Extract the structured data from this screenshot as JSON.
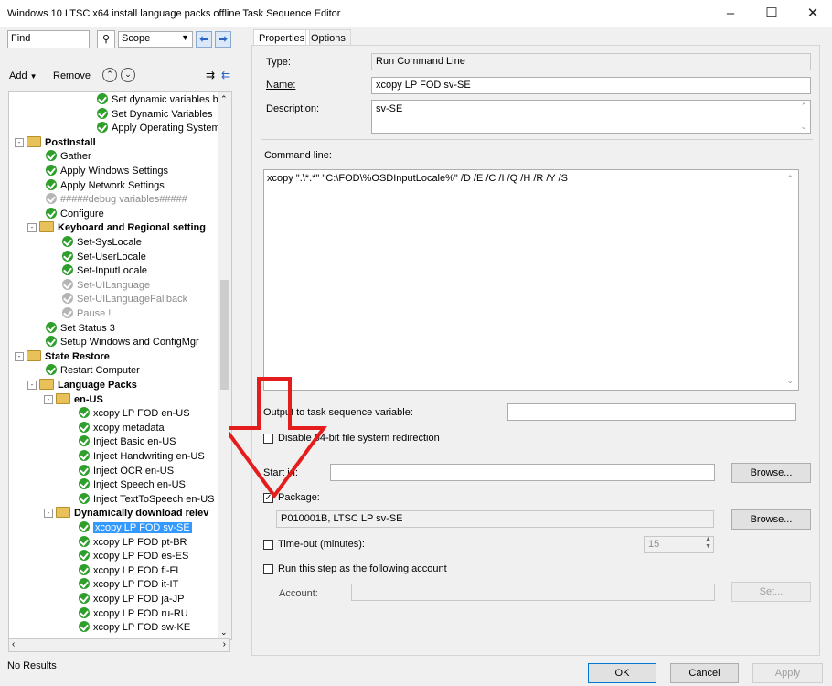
{
  "window": {
    "title": "Windows 10 LTSC x64 install language packs offline Task Sequence Editor"
  },
  "search": {
    "value": "Find",
    "scope": "Scope"
  },
  "toolbar": {
    "add": "Add",
    "remove": "Remove"
  },
  "tree": [
    {
      "label": "Set dynamic variables ba",
      "icon": "ok"
    },
    {
      "label": "Set Dynamic Variables",
      "icon": "ok"
    },
    {
      "label": "Apply Operating System I",
      "icon": "ok"
    },
    {
      "label": "PostInstall",
      "icon": "folder"
    },
    {
      "label": "Gather",
      "icon": "ok"
    },
    {
      "label": "Apply Windows Settings",
      "icon": "ok"
    },
    {
      "label": "Apply Network Settings",
      "icon": "ok"
    },
    {
      "label": "#####debug variables#####",
      "icon": "grey"
    },
    {
      "label": "Configure",
      "icon": "ok"
    },
    {
      "label": "Keyboard and Regional setting",
      "icon": "folder"
    },
    {
      "label": "Set-SysLocale",
      "icon": "ok"
    },
    {
      "label": "Set-UserLocale",
      "icon": "ok"
    },
    {
      "label": "Set-InputLocale",
      "icon": "ok"
    },
    {
      "label": "Set-UILanguage",
      "icon": "grey"
    },
    {
      "label": "Set-UILanguageFallback",
      "icon": "grey"
    },
    {
      "label": "Pause !",
      "icon": "grey"
    },
    {
      "label": "Set Status 3",
      "icon": "ok"
    },
    {
      "label": "Setup Windows and ConfigMgr",
      "icon": "ok"
    },
    {
      "label": "State Restore",
      "icon": "folder"
    },
    {
      "label": "Restart Computer",
      "icon": "ok"
    },
    {
      "label": "Language Packs",
      "icon": "folder"
    },
    {
      "label": "en-US",
      "icon": "folder"
    },
    {
      "label": "xcopy LP FOD en-US",
      "icon": "ok"
    },
    {
      "label": "xcopy metadata",
      "icon": "ok"
    },
    {
      "label": "Inject Basic en-US",
      "icon": "ok"
    },
    {
      "label": "Inject Handwriting en-US",
      "icon": "ok"
    },
    {
      "label": "Inject OCR en-US",
      "icon": "ok"
    },
    {
      "label": "Inject Speech en-US",
      "icon": "ok"
    },
    {
      "label": "Inject TextToSpeech en-US",
      "icon": "ok"
    },
    {
      "label": "Dynamically download relev",
      "icon": "folder"
    },
    {
      "label": "xcopy LP FOD sv-SE",
      "icon": "ok"
    },
    {
      "label": "xcopy LP FOD pt-BR",
      "icon": "ok"
    },
    {
      "label": "xcopy LP FOD es-ES",
      "icon": "ok"
    },
    {
      "label": "xcopy LP FOD fi-FI",
      "icon": "ok"
    },
    {
      "label": "xcopy LP FOD it-IT",
      "icon": "ok"
    },
    {
      "label": "xcopy LP FOD ja-JP",
      "icon": "ok"
    },
    {
      "label": "xcopy LP FOD  ru-RU",
      "icon": "ok"
    },
    {
      "label": "xcopy LP FOD sw-KE",
      "icon": "ok"
    }
  ],
  "status": {
    "text": "No Results"
  },
  "tabs": {
    "properties": "Properties",
    "options": "Options"
  },
  "props": {
    "type_label": "Type:",
    "type_value": "Run Command Line",
    "name_label": "Name:",
    "name_value": "xcopy LP FOD sv-SE",
    "desc_label": "Description:",
    "desc_value": "sv-SE",
    "cmd_label": "Command line:",
    "cmd_value": "xcopy \".\\*.*\" \"C:\\FOD\\%OSDInputLocale%\" /D /E /C /I /Q /H /R /Y /S",
    "output_label": "Output to task sequence variable:",
    "output_value": "",
    "disable_label": "Disable 64-bit file system redirection",
    "startin_label": "Start in:",
    "startin_value": "",
    "browse1": "Browse...",
    "package_label": "Package:",
    "package_value": "P010001B, LTSC LP sv-SE",
    "browse2": "Browse...",
    "timeout_label": "Time-out (minutes):",
    "timeout_value": "15",
    "runas_label": "Run this step as the following account",
    "account_label": "Account:",
    "account_value": "",
    "set_button": "Set..."
  },
  "buttons": {
    "ok": "OK",
    "cancel": "Cancel",
    "apply": "Apply"
  },
  "colors": {
    "arrow": "#e51c1c",
    "selection": "#3399ff",
    "ok_icon": "#2e9f2b"
  }
}
